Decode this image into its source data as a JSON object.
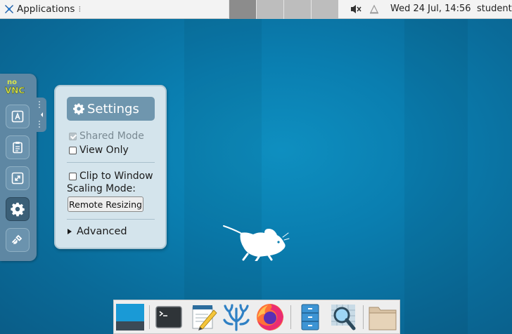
{
  "top_panel": {
    "applications_label": "Applications",
    "applications_separator": "⁝",
    "clock": "Wed 24 Jul, 14:56",
    "user": "student",
    "workspaces": [
      {
        "id": "ws1",
        "active": true
      },
      {
        "id": "ws2",
        "active": false
      },
      {
        "id": "ws3",
        "active": false
      },
      {
        "id": "ws4",
        "active": false
      }
    ],
    "tray_icons": [
      "volume-muted-icon",
      "notification-icon"
    ]
  },
  "novnc_bar": {
    "logo_text_top": "no",
    "logo_text_bottom": "VNC",
    "buttons": [
      {
        "name": "keyboard-icon",
        "selected": false
      },
      {
        "name": "clipboard-icon",
        "selected": false
      },
      {
        "name": "fullscreen-icon",
        "selected": false
      },
      {
        "name": "settings-gear-icon",
        "selected": true
      },
      {
        "name": "disconnect-icon",
        "selected": false
      }
    ]
  },
  "settings": {
    "title": "Settings",
    "shared_mode": {
      "label": "Shared Mode",
      "checked": true,
      "disabled": true
    },
    "view_only": {
      "label": "View Only",
      "checked": false
    },
    "clip_to_window": {
      "label": "Clip to Window",
      "checked": false
    },
    "scaling_mode_label": "Scaling Mode:",
    "scaling_mode_value": "Remote Resizing",
    "advanced_label": "Advanced"
  },
  "dock": {
    "items": [
      "show-desktop-icon",
      "terminal-icon",
      "text-editor-icon",
      "coral-app-icon",
      "firefox-icon",
      "file-cabinet-icon",
      "search-magnifier-icon",
      "folder-icon"
    ]
  },
  "colors": {
    "desktop_blue": "#0a7eb0",
    "panel_bg": "#f3f3f3",
    "novnc_bar": "#5e87a3",
    "settings_bg": "#d4e4ec",
    "settings_header": "#6f96ae"
  }
}
